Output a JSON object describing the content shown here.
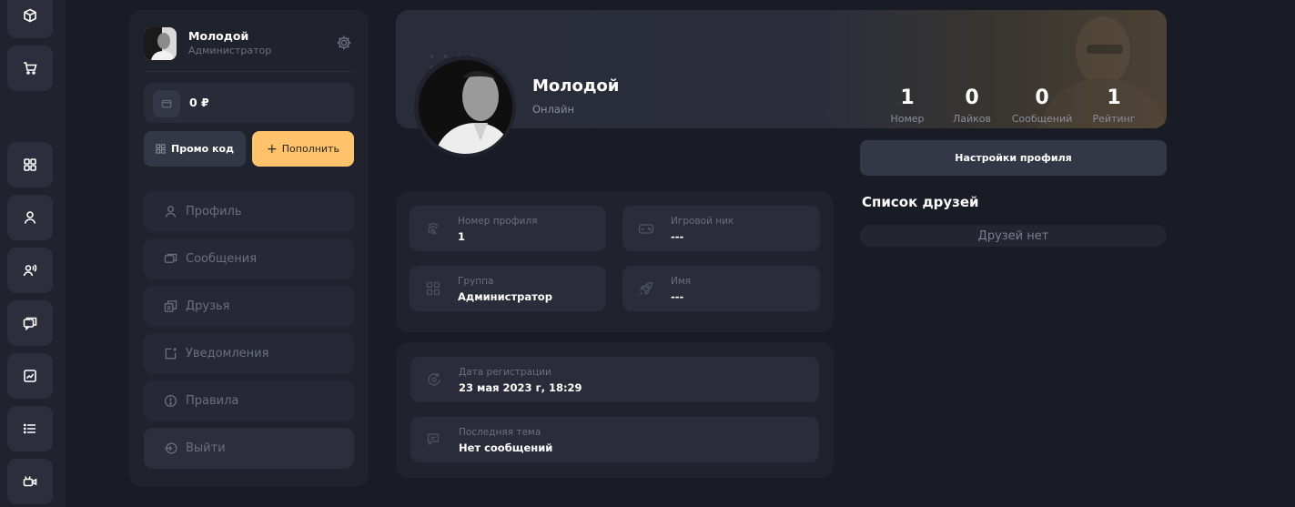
{
  "user": {
    "name": "Молодой",
    "role": "Администратор",
    "status": "Онлайн"
  },
  "wallet": {
    "balance": "0 ₽",
    "promo_label": "Промо код",
    "topup_label": "Пополнить"
  },
  "menu": [
    {
      "label": "Профиль",
      "icon": "user-icon"
    },
    {
      "label": "Сообщения",
      "icon": "chat-icon"
    },
    {
      "label": "Друзья",
      "icon": "friends-icon"
    },
    {
      "label": "Уведомления",
      "icon": "bell-icon"
    },
    {
      "label": "Правила",
      "icon": "info-icon"
    },
    {
      "label": "Выйти",
      "icon": "logout-icon"
    }
  ],
  "stats": [
    {
      "value": "1",
      "label": "Номер"
    },
    {
      "value": "0",
      "label": "Лайков"
    },
    {
      "value": "0",
      "label": "Сообщений"
    },
    {
      "value": "1",
      "label": "Рейтинг"
    }
  ],
  "settings_label": "Настройки профиля",
  "friends": {
    "title": "Список друзей",
    "empty": "Друзей нет"
  },
  "info": [
    {
      "label": "Номер профиля",
      "value": "1",
      "icon": "fingerprint-icon"
    },
    {
      "label": "Игровой ник",
      "value": "---",
      "icon": "gamepad-icon"
    },
    {
      "label": "Группа",
      "value": "Администратор",
      "icon": "grid-icon"
    },
    {
      "label": "Имя",
      "value": "---",
      "icon": "rocket-icon"
    }
  ],
  "extra": [
    {
      "label": "Дата регистрации",
      "value": "23 мая 2023 г, 18:29",
      "icon": "calendar-icon"
    },
    {
      "label": "Последняя тема",
      "value": "Нет сообщений",
      "icon": "messages-icon"
    }
  ],
  "leftbar": [
    "box-icon",
    "cart-icon",
    "dashboard-icon",
    "profile-icon",
    "users-icon",
    "forum-icon",
    "stats-icon",
    "list-icon",
    "video-icon"
  ]
}
